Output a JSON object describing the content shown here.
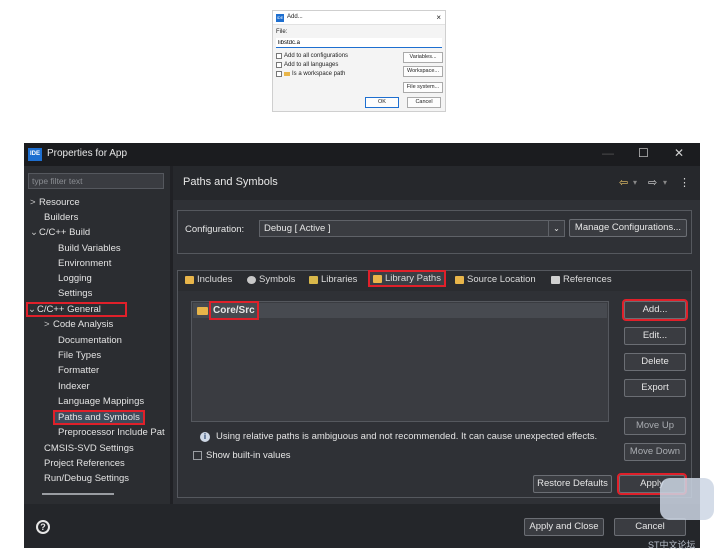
{
  "add_dialog": {
    "title": "Add...",
    "close": "×",
    "logo": "IDE",
    "file_label": "File:",
    "file_value": "libstdc.a",
    "options": [
      {
        "label": "Add to all configurations"
      },
      {
        "label": "Add to all languages"
      },
      {
        "label": "Is a workspace path"
      }
    ],
    "buttons": {
      "variables": "Variables...",
      "workspace": "Workspace...",
      "file_system": "File system...",
      "ok": "OK",
      "cancel": "Cancel"
    }
  },
  "window": {
    "logo": "IDE",
    "title": "Properties for App",
    "controls": {
      "minimize": "—",
      "maximize": "☐",
      "close": "✕"
    }
  },
  "sidebar": {
    "filter_placeholder": "type filter text",
    "items": [
      {
        "label": "Resource",
        "chevron": ">"
      },
      {
        "label": "Builders",
        "chevron": ""
      },
      {
        "label": "C/C++ Build",
        "chevron": "⌄"
      },
      {
        "label": "Build Variables",
        "chevron": ""
      },
      {
        "label": "Environment",
        "chevron": ""
      },
      {
        "label": "Logging",
        "chevron": ""
      },
      {
        "label": "Settings",
        "chevron": ""
      },
      {
        "label": "C/C++ General",
        "chevron": "⌄"
      },
      {
        "label": "Code Analysis",
        "chevron": ">"
      },
      {
        "label": "Documentation",
        "chevron": ""
      },
      {
        "label": "File Types",
        "chevron": ""
      },
      {
        "label": "Formatter",
        "chevron": ""
      },
      {
        "label": "Indexer",
        "chevron": ""
      },
      {
        "label": "Language Mappings",
        "chevron": ""
      },
      {
        "label": "Paths and Symbols",
        "chevron": ""
      },
      {
        "label": "Preprocessor Include Pat",
        "chevron": ""
      },
      {
        "label": "CMSIS-SVD Settings",
        "chevron": ""
      },
      {
        "label": "Project References",
        "chevron": ""
      },
      {
        "label": "Run/Debug Settings",
        "chevron": ""
      }
    ]
  },
  "panel": {
    "title": "Paths and Symbols",
    "nav": {
      "back": "⇦",
      "back_menu": "▾",
      "forward": "⇨",
      "forward_menu": "▾",
      "more": "⋮"
    },
    "configuration_label": "Configuration:",
    "configuration_value": "Debug  [ Active ]",
    "manage_button": "Manage Configurations...",
    "tabs": [
      {
        "label": "Includes",
        "icon": "includes-icon",
        "color": "#e8b54a"
      },
      {
        "label": "Symbols",
        "icon": "symbols-icon",
        "color": "#c8c8c8"
      },
      {
        "label": "Libraries",
        "icon": "libraries-icon",
        "color": "#d9b84a"
      },
      {
        "label": "Library Paths",
        "icon": "library-paths-icon",
        "color": "#e8b54a"
      },
      {
        "label": "Source Location",
        "icon": "source-location-icon",
        "color": "#e8b54a"
      },
      {
        "label": "References",
        "icon": "references-icon",
        "color": "#d0d0d0"
      }
    ],
    "list_items": [
      {
        "label": "Core/Src"
      }
    ],
    "side_buttons": {
      "add": "Add...",
      "edit": "Edit...",
      "delete": "Delete",
      "export": "Export",
      "move_up": "Move Up",
      "move_down": "Move Down"
    },
    "info_text": "Using relative paths is ambiguous and not recommended. It can cause unexpected effects.",
    "show_builtin_label": "Show built-in values",
    "restore_defaults": "Restore Defaults",
    "apply": "Apply"
  },
  "footer": {
    "help": "?",
    "apply_and_close": "Apply and Close",
    "cancel": "Cancel"
  },
  "watermark": "ST中文论坛",
  "colors": {
    "highlight": "#e0202a",
    "accent": "#1e6fd0",
    "folder": "#e8b54a"
  }
}
